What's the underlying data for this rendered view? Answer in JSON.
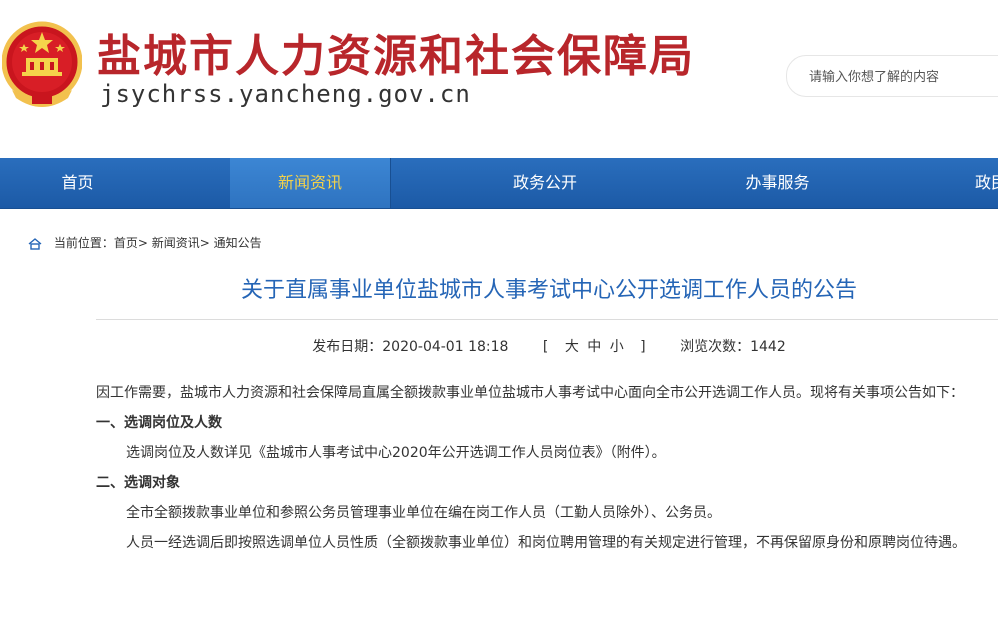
{
  "header": {
    "site_title": "盐城市人力资源和社会保障局",
    "site_domain": "jsychrss.yancheng.gov.cn",
    "emblem_icon": "national-emblem-icon",
    "search_placeholder": "请输入你想了解的内容"
  },
  "nav": {
    "items": [
      {
        "label": "首页",
        "active": false
      },
      {
        "label": "新闻资讯",
        "active": true
      },
      {
        "label": "政务公开",
        "active": false
      },
      {
        "label": "办事服务",
        "active": false
      },
      {
        "label": "政民",
        "active": false
      }
    ],
    "colors": {
      "bar": "#1f62b0",
      "active_text": "#f3d24a"
    }
  },
  "breadcrumb": {
    "icon": "home-icon",
    "prefix": "当前位置：",
    "items": [
      "首页",
      "新闻资讯",
      "通知公告"
    ],
    "separator": ">"
  },
  "article": {
    "title": "关于直属事业单位盐城市人事考试中心公开选调工作人员的公告",
    "meta": {
      "date": "发布日期：2020-04-01 18:18",
      "font_ctl_open": "[",
      "font_large": "大",
      "font_medium": "中",
      "font_small": "小",
      "font_ctl_close": "]",
      "views": "浏览次数：1442"
    },
    "paragraphs": {
      "intro": "因工作需要，盐城市人力资源和社会保障局直属全额拨款事业单位盐城市人事考试中心面向全市公开选调工作人员。现将有关事项公告如下：",
      "h1": "一、选调岗位及人数",
      "p1": "选调岗位及人数详见《盐城市人事考试中心2020年公开选调工作人员岗位表》（附件）。",
      "h2": "二、选调对象",
      "p2": "全市全额拨款事业单位和参照公务员管理事业单位在编在岗工作人员（工勤人员除外）、公务员。",
      "p3": "人员一经选调后即按照选调单位人员性质（全额拨款事业单位）和岗位聘用管理的有关规定进行管理，不再保留原身份和原聘岗位待遇。"
    },
    "colors": {
      "title": "#2565b6",
      "brand_red": "#b8262b"
    }
  }
}
